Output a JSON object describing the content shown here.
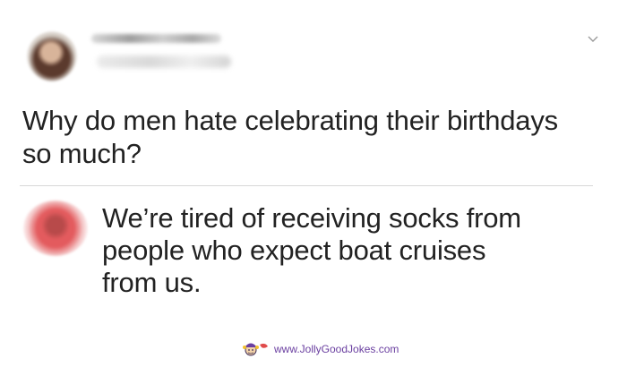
{
  "post": {
    "text": "Why do men hate celebrating their birthdays so much?"
  },
  "reply": {
    "text": "We’re tired of receiving socks from people who expect boat cruises from us."
  },
  "icons": {
    "menu": "chevron-down-icon",
    "watermark_mascot": "jester-icon"
  },
  "watermark": {
    "text": "www.JollyGoodJokes.com",
    "color": "#6a3fa0"
  },
  "colors": {
    "text": "#222222",
    "divider": "#d7d7d7",
    "background": "#ffffff"
  }
}
